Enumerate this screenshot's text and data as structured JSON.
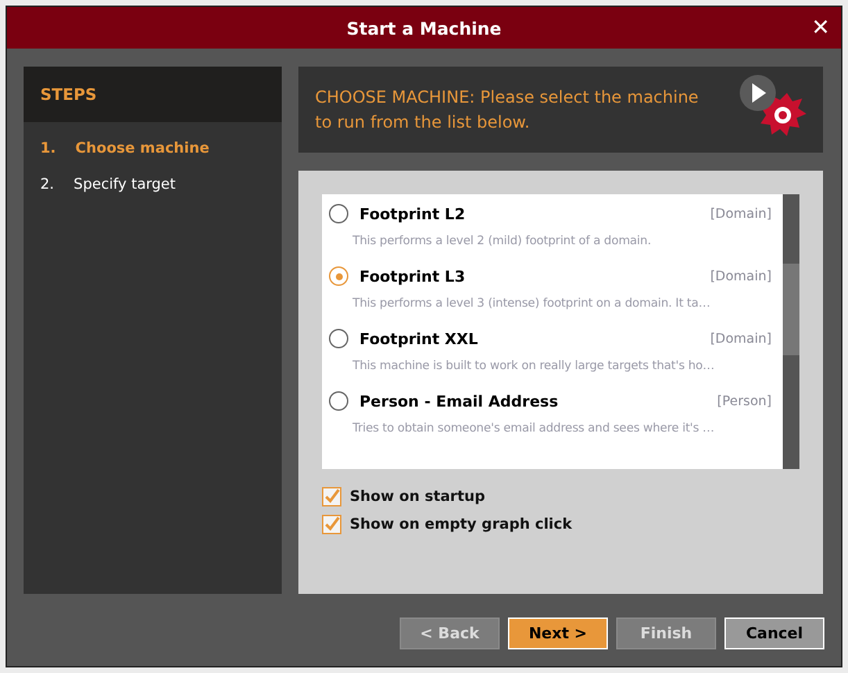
{
  "window": {
    "title": "Start a Machine",
    "close": "✕"
  },
  "steps": {
    "title": "STEPS",
    "items": [
      {
        "number": "1.",
        "label": "Choose machine",
        "selected": true
      },
      {
        "number": "2.",
        "label": "Specify target",
        "selected": false
      }
    ]
  },
  "header": {
    "lead": "CHOOSE MACHINE:",
    "text": "Please select the machine to run from the list below."
  },
  "machines": [
    {
      "name": "Footprint L2",
      "type": "[Domain]",
      "description": "This performs a level 2 (mild) footprint of a domain.",
      "selected": false
    },
    {
      "name": "Footprint L3",
      "type": "[Domain]",
      "description": "This performs a level 3 (intense) footprint on a domain. It ta…",
      "selected": true
    },
    {
      "name": "Footprint XXL",
      "type": "[Domain]",
      "description": "This machine is built to work on really large targets that's ho…",
      "selected": false
    },
    {
      "name": "Person - Email Address",
      "type": "[Person]",
      "description": "Tries to obtain someone's email address and sees where it's …",
      "selected": false
    }
  ],
  "options": [
    {
      "label": "Show on startup",
      "checked": true
    },
    {
      "label": "Show on empty graph click",
      "checked": true
    }
  ],
  "buttons": [
    {
      "label": "< Back",
      "kind": "normal",
      "disabled": true
    },
    {
      "label": "Next >",
      "kind": "primary",
      "disabled": false
    },
    {
      "label": "Finish",
      "kind": "normal",
      "disabled": true
    },
    {
      "label": "Cancel",
      "kind": "normal",
      "disabled": false
    }
  ]
}
